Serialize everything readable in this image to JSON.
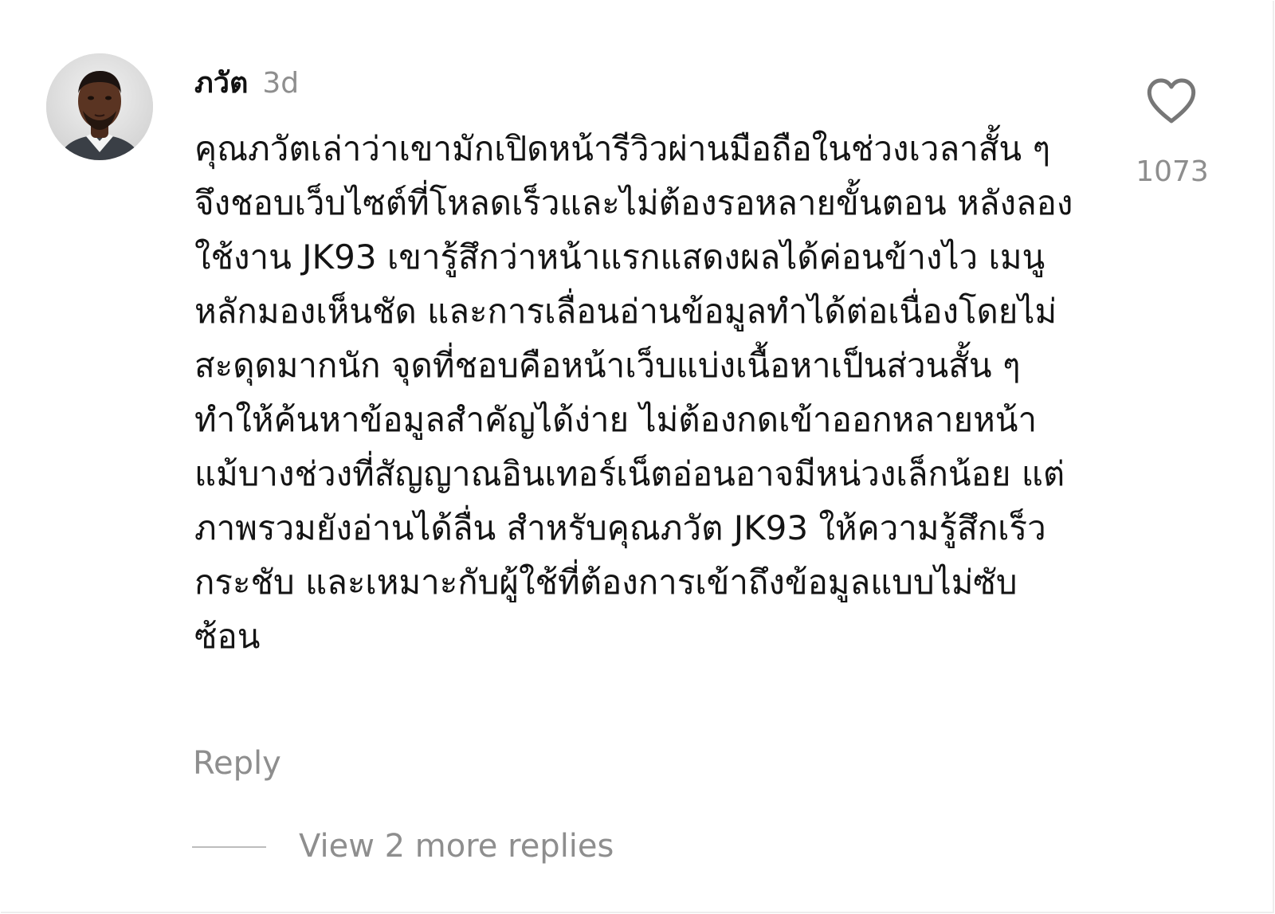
{
  "comment": {
    "author": "ภวัต",
    "time_ago": "3d",
    "text": "คุณภวัตเล่าว่าเขามักเปิดหน้ารีวิวผ่านมือถือในช่วงเวลาสั้น ๆ จึงชอบเว็บไซต์ที่โหลดเร็วและไม่ต้องรอหลายขั้นตอน หลังลองใช้งาน JK93 เขารู้สึกว่าหน้าแรกแสดงผลได้ค่อนข้างไว เมนูหลักมองเห็นชัด และการเลื่อนอ่านข้อมูลทำได้ต่อเนื่องโดยไม่สะดุดมากนัก จุดที่ชอบคือหน้าเว็บแบ่งเนื้อหาเป็นส่วนสั้น ๆ ทำให้ค้นหาข้อมูลสำคัญได้ง่าย ไม่ต้องกดเข้าออกหลายหน้า แม้บางช่วงที่สัญญาณอินเทอร์เน็ตอ่อนอาจมีหน่วงเล็กน้อย แต่ภาพรวมยังอ่านได้ลื่น สำหรับคุณภวัต JK93 ให้ความรู้สึกเร็ว กระชับ และเหมาะกับผู้ใช้ที่ต้องการเข้าถึงข้อมูลแบบไม่ซับซ้อน",
    "like_count": "1073",
    "reply_label": "Reply",
    "view_replies_label": "View 2 more replies"
  },
  "icons": {
    "like": "heart-outline-icon",
    "avatar": "user-avatar-photo"
  },
  "colors": {
    "primary_text": "#141414",
    "secondary_text": "#8e8e8e",
    "divider": "#bdbdbd",
    "background": "#ffffff"
  }
}
